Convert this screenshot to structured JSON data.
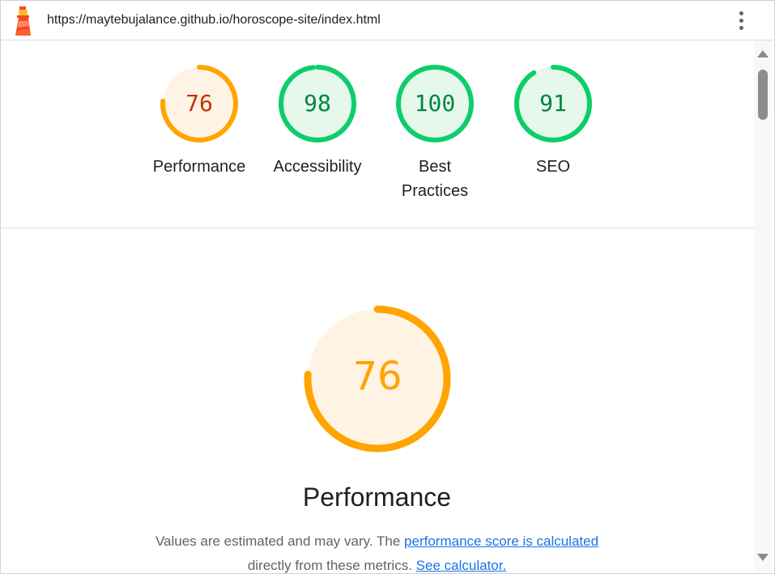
{
  "header": {
    "url": "https://maytebujalance.github.io/horoscope-site/index.html",
    "logo_icon": "lighthouse-icon",
    "menu_icon": "kebab-menu-icon"
  },
  "colors": {
    "average": "#ffa400",
    "average_text": "#c33300",
    "average_bg": "#fff3e4",
    "pass": "#0cce6b",
    "pass_text": "#018642",
    "pass_bg": "#e6f8ec"
  },
  "gauges": [
    {
      "score": "76",
      "label": "Performance",
      "value": 0.76,
      "rating": "average"
    },
    {
      "score": "98",
      "label": "Accessibility",
      "value": 0.98,
      "rating": "pass"
    },
    {
      "score": "100",
      "label": "Best Practices",
      "value": 1.0,
      "rating": "pass"
    },
    {
      "score": "91",
      "label": "SEO",
      "value": 0.91,
      "rating": "pass"
    }
  ],
  "main": {
    "score": "76",
    "value": 0.76,
    "title": "Performance",
    "desc_text_1": "Values are estimated and may vary. The ",
    "desc_link_1": "performance score is calculated",
    "desc_text_2": "directly from these metrics. ",
    "desc_link_2": "See calculator."
  }
}
